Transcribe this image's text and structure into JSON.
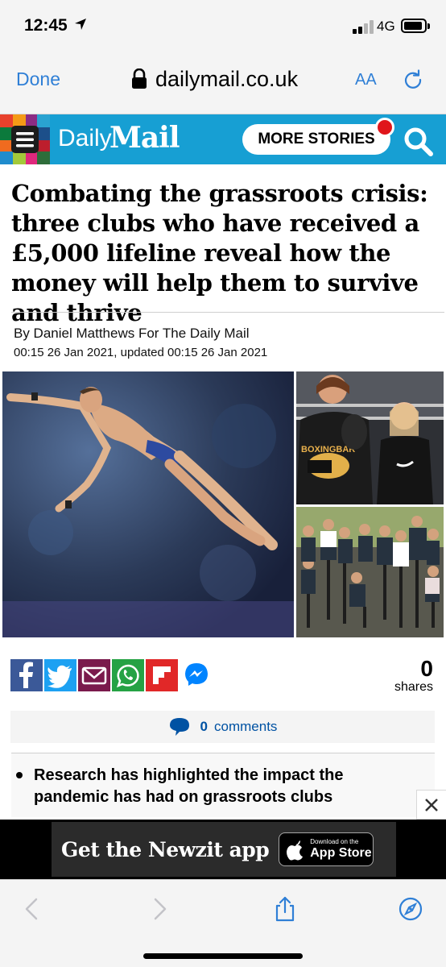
{
  "status_bar": {
    "time": "12:45",
    "network": "4G"
  },
  "safari": {
    "done_label": "Done",
    "url": "dailymail.co.uk",
    "text_size_label": "AA"
  },
  "site_header": {
    "logo_daily": "Daily",
    "logo_mail": "Mail",
    "more_stories_label": "MORE STORIES",
    "brand_color": "#179fd3",
    "notification_color": "#e0151b"
  },
  "article": {
    "headline": "Combating the grassroots crisis: three clubs who have received a £5,000 lifeline reveal how the money will help them to survive and thrive",
    "byline": "By Daniel Matthews For The Daily Mail",
    "dateline": "00:15 26 Jan 2021, updated 00:15 26 Jan 2021",
    "boxing_banner_text": "BOXINGBAR",
    "bullets": [
      "Research has highlighted the impact the pandemic has had on grassroots clubs"
    ]
  },
  "share": {
    "buttons": [
      {
        "name": "facebook",
        "color": "#3b5998"
      },
      {
        "name": "twitter",
        "color": "#1da1f2"
      },
      {
        "name": "email",
        "color": "#7a1a4c"
      },
      {
        "name": "whatsapp",
        "color": "#25a244"
      },
      {
        "name": "flipboard",
        "color": "#e12828"
      },
      {
        "name": "messenger",
        "color": "#0084ff"
      }
    ],
    "count": "0",
    "count_label": "shares"
  },
  "comments": {
    "count": "0",
    "label": "comments"
  },
  "ad": {
    "text": "Get the Newzit app",
    "store_small": "Download on the",
    "store_big": "App Store"
  }
}
